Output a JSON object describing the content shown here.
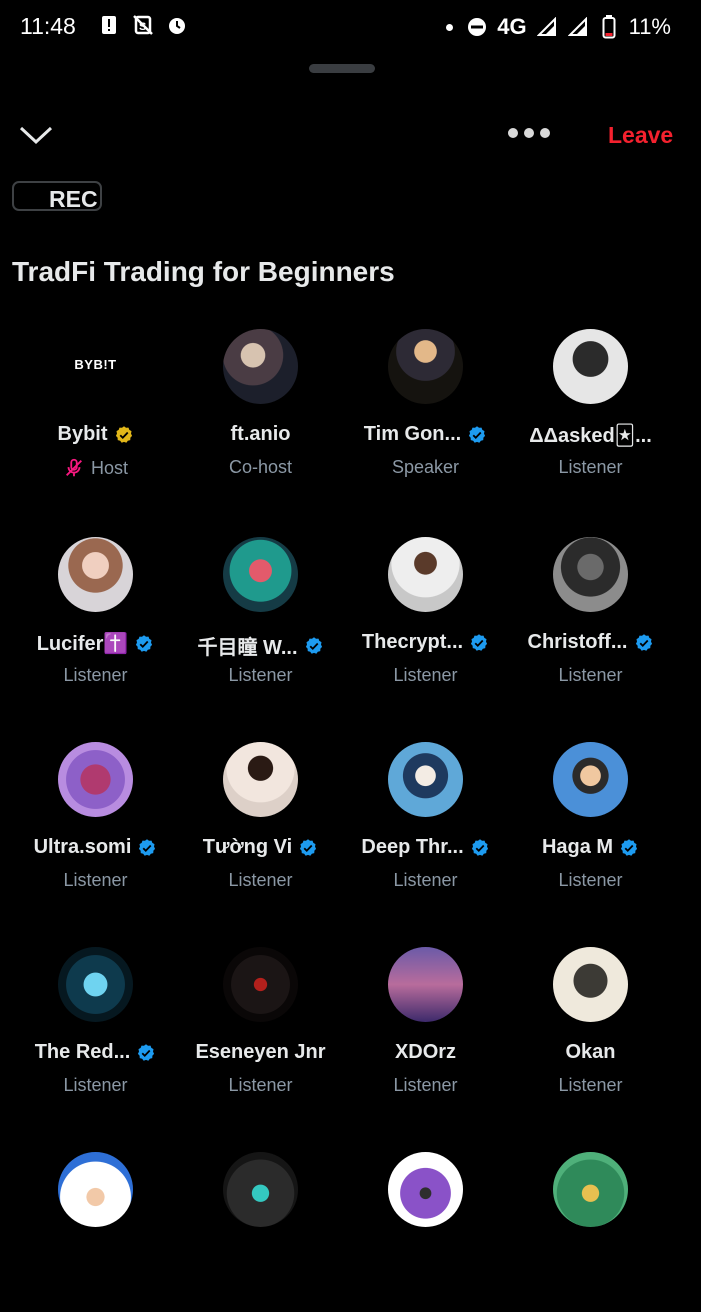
{
  "status_bar": {
    "time": "11:48",
    "network": "4G",
    "battery": "11%"
  },
  "header": {
    "leave_label": "Leave",
    "rec_label": "REC",
    "more_icon": "more-dots-icon",
    "collapse_icon": "chevron-down-icon"
  },
  "space": {
    "title": "TradFi Trading for Beginners"
  },
  "colors": {
    "leave": "#f4212e",
    "verified_blue": "#1d9bf0",
    "verified_gold": "#e2b719",
    "muted_mic": "#f91880"
  },
  "participants": [
    {
      "name": "Bybit",
      "role": "Host",
      "badge": "gold",
      "muted": true
    },
    {
      "name": "ft.anio",
      "role": "Co-host",
      "badge": "",
      "muted": false
    },
    {
      "name": "Tim Gon...",
      "role": "Speaker",
      "badge": "blue",
      "muted": false
    },
    {
      "name": "ΔΔasked🃏...",
      "role": "Listener",
      "badge": "",
      "muted": false
    },
    {
      "name": "Lucifer✝️",
      "role": "Listener",
      "badge": "blue",
      "muted": false
    },
    {
      "name": "千目瞳 W...",
      "role": "Listener",
      "badge": "blue",
      "muted": false
    },
    {
      "name": "Thecrypt...",
      "role": "Listener",
      "badge": "blue",
      "muted": false
    },
    {
      "name": "Christoff...",
      "role": "Listener",
      "badge": "blue",
      "muted": false
    },
    {
      "name": "Ultra.somi",
      "role": "Listener",
      "badge": "blue",
      "muted": false
    },
    {
      "name": "Tường Vi",
      "role": "Listener",
      "badge": "blue",
      "muted": false
    },
    {
      "name": "Deep Thr...",
      "role": "Listener",
      "badge": "blue",
      "muted": false
    },
    {
      "name": "Haga M",
      "role": "Listener",
      "badge": "blue",
      "muted": false
    },
    {
      "name": "The Red...",
      "role": "Listener",
      "badge": "blue",
      "muted": false
    },
    {
      "name": "Eseneyen Jnr",
      "role": "Listener",
      "badge": "",
      "muted": false
    },
    {
      "name": "XDOrz",
      "role": "Listener",
      "badge": "",
      "muted": false
    },
    {
      "name": "Okan",
      "role": "Listener",
      "badge": "",
      "muted": false
    },
    {
      "name": "",
      "role": "",
      "badge": "",
      "muted": false
    },
    {
      "name": "",
      "role": "",
      "badge": "",
      "muted": false
    },
    {
      "name": "",
      "role": "",
      "badge": "",
      "muted": false
    },
    {
      "name": "",
      "role": "",
      "badge": "",
      "muted": false
    }
  ],
  "avatar_logo_text": "BYB!T"
}
